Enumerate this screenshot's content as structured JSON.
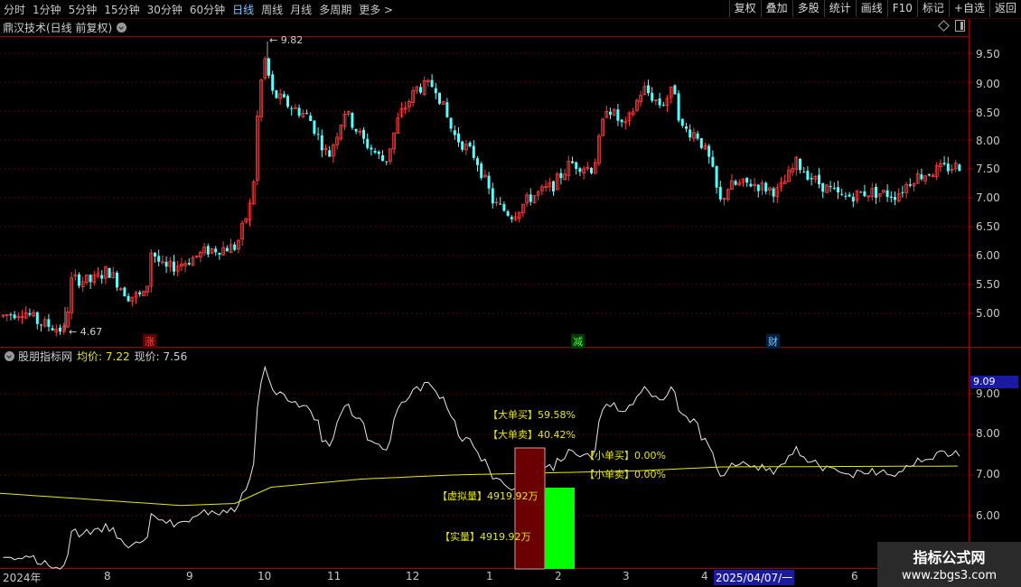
{
  "toolbar": {
    "periods": [
      "分时",
      "1分钟",
      "5分钟",
      "15分钟",
      "30分钟",
      "60分钟",
      "日线",
      "周线",
      "月线",
      "多周期",
      "更多 >"
    ],
    "active_period": "日线",
    "buttons": [
      "复权",
      "叠加",
      "多股",
      "统计",
      "画线",
      "F10",
      "标记",
      "+自选",
      "返回"
    ]
  },
  "main_chart": {
    "title": "鼎汉技术(日线 前复权)",
    "high_label": "9.82",
    "low_label": "4.67",
    "y_ticks": [
      "9.50",
      "9.00",
      "8.50",
      "8.00",
      "7.50",
      "7.00",
      "6.50",
      "6.00",
      "5.50",
      "5.00"
    ],
    "tags": [
      {
        "text": "涨",
        "color": "#ff4a4a"
      },
      {
        "text": "减",
        "color": "#40ff40"
      },
      {
        "text": "财",
        "color": "#7ec8ff"
      }
    ]
  },
  "indicator": {
    "name": "股朋指标网",
    "avg_label": "均价:",
    "avg_value": "7.22",
    "cur_label": "现价:",
    "cur_value": "7.56",
    "y_ticks": [
      "9.00",
      "8.00",
      "7.00",
      "6.00"
    ],
    "current_marker": "9.09",
    "annotations": {
      "big_buy": "【大单买】59.58%",
      "big_sell": "【大单卖】40.42%",
      "small_buy": "【小单买】0.00%",
      "small_sell": "【小单卖】0.00%",
      "virtual_vol": "【虚拟量】4919.92万",
      "real_vol": "【实量】4919.92万"
    }
  },
  "date_axis": {
    "labels": [
      "2024年",
      "8",
      "9",
      "10",
      "11",
      "12",
      "1",
      "2",
      "3",
      "4",
      "2025/04/07/一",
      "6"
    ]
  },
  "watermark": {
    "line1": "指标公式网",
    "line2": "www.zbgs3.com"
  },
  "colors": {
    "up": "#ff3c3c",
    "down": "#54ffff",
    "avg_line": "#e8e800",
    "grid": "#5a0000",
    "frame": "#a00000"
  }
}
